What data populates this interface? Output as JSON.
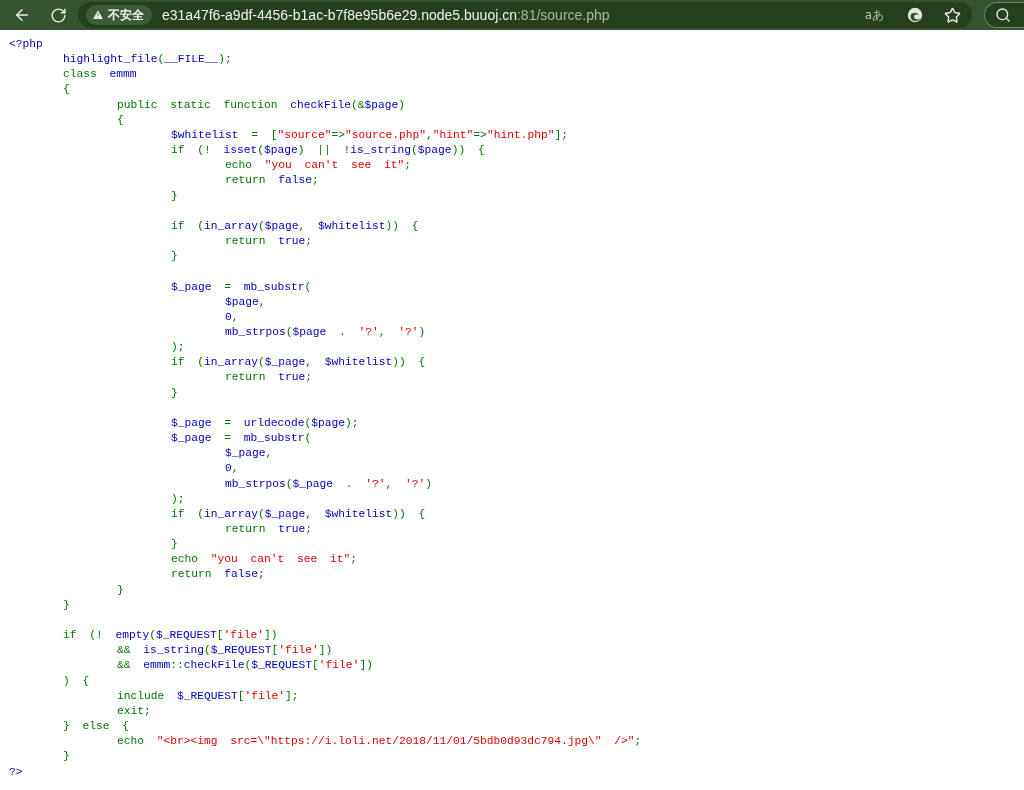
{
  "address_bar": {
    "security_label": "不安全",
    "url_host": "e31a47f6-a9df-4456-b1ac-b7f8e95b6e29.node5.buuoj.cn",
    "url_rest": ":81/source.php",
    "reader_label": "aあ"
  },
  "code_lines": [
    {
      "kind": "code",
      "segments": [
        {
          "kind": "default",
          "text": "<?php"
        }
      ],
      "children": [
        {
          "kind": "code",
          "segments": [
            {
              "kind": "default",
              "text": "highlight_file"
            },
            {
              "kind": "keyword",
              "text": "("
            },
            {
              "kind": "default",
              "text": "__FILE__"
            },
            {
              "kind": "keyword",
              "text": ");"
            }
          ]
        },
        {
          "kind": "code",
          "segments": [
            {
              "kind": "keyword",
              "text": "class "
            },
            {
              "kind": "default",
              "text": "emmm"
            }
          ]
        },
        {
          "kind": "code",
          "segments": [
            {
              "kind": "keyword",
              "text": "{"
            }
          ],
          "children": [
            {
              "kind": "code",
              "segments": [
                {
                  "kind": "keyword",
                  "text": "public static function "
                },
                {
                  "kind": "default",
                  "text": "checkFile"
                },
                {
                  "kind": "keyword",
                  "text": "(&"
                },
                {
                  "kind": "default",
                  "text": "$page"
                },
                {
                  "kind": "keyword",
                  "text": ")"
                }
              ]
            },
            {
              "kind": "code",
              "segments": [
                {
                  "kind": "keyword",
                  "text": "{"
                }
              ],
              "children": [
                {
                  "kind": "code",
                  "segments": [
                    {
                      "kind": "default",
                      "text": "$whitelist "
                    },
                    {
                      "kind": "keyword",
                      "text": "= ["
                    },
                    {
                      "kind": "string",
                      "text": "\"source\""
                    },
                    {
                      "kind": "keyword",
                      "text": "=>"
                    },
                    {
                      "kind": "string",
                      "text": "\"source.php\""
                    },
                    {
                      "kind": "keyword",
                      "text": ","
                    },
                    {
                      "kind": "string",
                      "text": "\"hint\""
                    },
                    {
                      "kind": "keyword",
                      "text": "=>"
                    },
                    {
                      "kind": "string",
                      "text": "\"hint.php\""
                    },
                    {
                      "kind": "keyword",
                      "text": "];"
                    }
                  ]
                },
                {
                  "kind": "code",
                  "segments": [
                    {
                      "kind": "keyword",
                      "text": "if (! "
                    },
                    {
                      "kind": "default",
                      "text": "isset"
                    },
                    {
                      "kind": "keyword",
                      "text": "("
                    },
                    {
                      "kind": "default",
                      "text": "$page"
                    },
                    {
                      "kind": "keyword",
                      "text": ") || !"
                    },
                    {
                      "kind": "default",
                      "text": "is_string"
                    },
                    {
                      "kind": "keyword",
                      "text": "("
                    },
                    {
                      "kind": "default",
                      "text": "$page"
                    },
                    {
                      "kind": "keyword",
                      "text": ")) {"
                    }
                  ],
                  "children": [
                    {
                      "kind": "code",
                      "segments": [
                        {
                          "kind": "keyword",
                          "text": "echo "
                        },
                        {
                          "kind": "string",
                          "text": "\"you can't see it\""
                        },
                        {
                          "kind": "keyword",
                          "text": ";"
                        }
                      ]
                    },
                    {
                      "kind": "code",
                      "segments": [
                        {
                          "kind": "keyword",
                          "text": "return "
                        },
                        {
                          "kind": "default",
                          "text": "false"
                        },
                        {
                          "kind": "keyword",
                          "text": ";"
                        }
                      ]
                    }
                  ]
                },
                {
                  "kind": "code",
                  "segments": [
                    {
                      "kind": "keyword",
                      "text": "}"
                    }
                  ]
                },
                {
                  "kind": "blank"
                },
                {
                  "kind": "code",
                  "segments": [
                    {
                      "kind": "keyword",
                      "text": "if ("
                    },
                    {
                      "kind": "default",
                      "text": "in_array"
                    },
                    {
                      "kind": "keyword",
                      "text": "("
                    },
                    {
                      "kind": "default",
                      "text": "$page"
                    },
                    {
                      "kind": "keyword",
                      "text": ", "
                    },
                    {
                      "kind": "default",
                      "text": "$whitelist"
                    },
                    {
                      "kind": "keyword",
                      "text": ")) {"
                    }
                  ],
                  "children": [
                    {
                      "kind": "code",
                      "segments": [
                        {
                          "kind": "keyword",
                          "text": "return "
                        },
                        {
                          "kind": "default",
                          "text": "true"
                        },
                        {
                          "kind": "keyword",
                          "text": ";"
                        }
                      ]
                    }
                  ]
                },
                {
                  "kind": "code",
                  "segments": [
                    {
                      "kind": "keyword",
                      "text": "}"
                    }
                  ]
                },
                {
                  "kind": "blank"
                },
                {
                  "kind": "code",
                  "segments": [
                    {
                      "kind": "default",
                      "text": "$_page "
                    },
                    {
                      "kind": "keyword",
                      "text": "= "
                    },
                    {
                      "kind": "default",
                      "text": "mb_substr"
                    },
                    {
                      "kind": "keyword",
                      "text": "("
                    }
                  ],
                  "children": [
                    {
                      "kind": "code",
                      "segments": [
                        {
                          "kind": "default",
                          "text": "$page"
                        },
                        {
                          "kind": "keyword",
                          "text": ","
                        }
                      ]
                    },
                    {
                      "kind": "code",
                      "segments": [
                        {
                          "kind": "default",
                          "text": "0"
                        },
                        {
                          "kind": "keyword",
                          "text": ","
                        }
                      ]
                    },
                    {
                      "kind": "code",
                      "segments": [
                        {
                          "kind": "default",
                          "text": "mb_strpos"
                        },
                        {
                          "kind": "keyword",
                          "text": "("
                        },
                        {
                          "kind": "default",
                          "text": "$page "
                        },
                        {
                          "kind": "keyword",
                          "text": ". "
                        },
                        {
                          "kind": "string",
                          "text": "'?'"
                        },
                        {
                          "kind": "keyword",
                          "text": ", "
                        },
                        {
                          "kind": "string",
                          "text": "'?'"
                        },
                        {
                          "kind": "keyword",
                          "text": ")"
                        }
                      ]
                    }
                  ]
                },
                {
                  "kind": "code",
                  "segments": [
                    {
                      "kind": "keyword",
                      "text": ");"
                    }
                  ]
                },
                {
                  "kind": "code",
                  "segments": [
                    {
                      "kind": "keyword",
                      "text": "if ("
                    },
                    {
                      "kind": "default",
                      "text": "in_array"
                    },
                    {
                      "kind": "keyword",
                      "text": "("
                    },
                    {
                      "kind": "default",
                      "text": "$_page"
                    },
                    {
                      "kind": "keyword",
                      "text": ", "
                    },
                    {
                      "kind": "default",
                      "text": "$whitelist"
                    },
                    {
                      "kind": "keyword",
                      "text": ")) {"
                    }
                  ],
                  "children": [
                    {
                      "kind": "code",
                      "segments": [
                        {
                          "kind": "keyword",
                          "text": "return "
                        },
                        {
                          "kind": "default",
                          "text": "true"
                        },
                        {
                          "kind": "keyword",
                          "text": ";"
                        }
                      ]
                    }
                  ]
                },
                {
                  "kind": "code",
                  "segments": [
                    {
                      "kind": "keyword",
                      "text": "}"
                    }
                  ]
                },
                {
                  "kind": "blank"
                },
                {
                  "kind": "code",
                  "segments": [
                    {
                      "kind": "default",
                      "text": "$_page "
                    },
                    {
                      "kind": "keyword",
                      "text": "= "
                    },
                    {
                      "kind": "default",
                      "text": "urldecode"
                    },
                    {
                      "kind": "keyword",
                      "text": "("
                    },
                    {
                      "kind": "default",
                      "text": "$page"
                    },
                    {
                      "kind": "keyword",
                      "text": ");"
                    }
                  ]
                },
                {
                  "kind": "code",
                  "segments": [
                    {
                      "kind": "default",
                      "text": "$_page "
                    },
                    {
                      "kind": "keyword",
                      "text": "= "
                    },
                    {
                      "kind": "default",
                      "text": "mb_substr"
                    },
                    {
                      "kind": "keyword",
                      "text": "("
                    }
                  ],
                  "children": [
                    {
                      "kind": "code",
                      "segments": [
                        {
                          "kind": "default",
                          "text": "$_page"
                        },
                        {
                          "kind": "keyword",
                          "text": ","
                        }
                      ]
                    },
                    {
                      "kind": "code",
                      "segments": [
                        {
                          "kind": "default",
                          "text": "0"
                        },
                        {
                          "kind": "keyword",
                          "text": ","
                        }
                      ]
                    },
                    {
                      "kind": "code",
                      "segments": [
                        {
                          "kind": "default",
                          "text": "mb_strpos"
                        },
                        {
                          "kind": "keyword",
                          "text": "("
                        },
                        {
                          "kind": "default",
                          "text": "$_page "
                        },
                        {
                          "kind": "keyword",
                          "text": ". "
                        },
                        {
                          "kind": "string",
                          "text": "'?'"
                        },
                        {
                          "kind": "keyword",
                          "text": ", "
                        },
                        {
                          "kind": "string",
                          "text": "'?'"
                        },
                        {
                          "kind": "keyword",
                          "text": ")"
                        }
                      ]
                    }
                  ]
                },
                {
                  "kind": "code",
                  "segments": [
                    {
                      "kind": "keyword",
                      "text": ");"
                    }
                  ]
                },
                {
                  "kind": "code",
                  "segments": [
                    {
                      "kind": "keyword",
                      "text": "if ("
                    },
                    {
                      "kind": "default",
                      "text": "in_array"
                    },
                    {
                      "kind": "keyword",
                      "text": "("
                    },
                    {
                      "kind": "default",
                      "text": "$_page"
                    },
                    {
                      "kind": "keyword",
                      "text": ", "
                    },
                    {
                      "kind": "default",
                      "text": "$whitelist"
                    },
                    {
                      "kind": "keyword",
                      "text": ")) {"
                    }
                  ],
                  "children": [
                    {
                      "kind": "code",
                      "segments": [
                        {
                          "kind": "keyword",
                          "text": "return "
                        },
                        {
                          "kind": "default",
                          "text": "true"
                        },
                        {
                          "kind": "keyword",
                          "text": ";"
                        }
                      ]
                    }
                  ]
                },
                {
                  "kind": "code",
                  "segments": [
                    {
                      "kind": "keyword",
                      "text": "}"
                    }
                  ]
                },
                {
                  "kind": "code",
                  "segments": [
                    {
                      "kind": "keyword",
                      "text": "echo "
                    },
                    {
                      "kind": "string",
                      "text": "\"you can't see it\""
                    },
                    {
                      "kind": "keyword",
                      "text": ";"
                    }
                  ]
                },
                {
                  "kind": "code",
                  "segments": [
                    {
                      "kind": "keyword",
                      "text": "return "
                    },
                    {
                      "kind": "default",
                      "text": "false"
                    },
                    {
                      "kind": "keyword",
                      "text": ";"
                    }
                  ]
                }
              ]
            },
            {
              "kind": "code",
              "segments": [
                {
                  "kind": "keyword",
                  "text": "}"
                }
              ]
            }
          ]
        },
        {
          "kind": "code",
          "segments": [
            {
              "kind": "keyword",
              "text": "}"
            }
          ]
        },
        {
          "kind": "blank"
        },
        {
          "kind": "code",
          "segments": [
            {
              "kind": "keyword",
              "text": "if (! "
            },
            {
              "kind": "default",
              "text": "empty"
            },
            {
              "kind": "keyword",
              "text": "("
            },
            {
              "kind": "default",
              "text": "$_REQUEST"
            },
            {
              "kind": "keyword",
              "text": "["
            },
            {
              "kind": "string",
              "text": "'file'"
            },
            {
              "kind": "keyword",
              "text": "])"
            }
          ],
          "children": [
            {
              "kind": "code",
              "segments": [
                {
                  "kind": "keyword",
                  "text": "&& "
                },
                {
                  "kind": "default",
                  "text": "is_string"
                },
                {
                  "kind": "keyword",
                  "text": "("
                },
                {
                  "kind": "default",
                  "text": "$_REQUEST"
                },
                {
                  "kind": "keyword",
                  "text": "["
                },
                {
                  "kind": "string",
                  "text": "'file'"
                },
                {
                  "kind": "keyword",
                  "text": "])"
                }
              ]
            },
            {
              "kind": "code",
              "segments": [
                {
                  "kind": "keyword",
                  "text": "&& "
                },
                {
                  "kind": "default",
                  "text": "emmm"
                },
                {
                  "kind": "keyword",
                  "text": "::"
                },
                {
                  "kind": "default",
                  "text": "checkFile"
                },
                {
                  "kind": "keyword",
                  "text": "("
                },
                {
                  "kind": "default",
                  "text": "$_REQUEST"
                },
                {
                  "kind": "keyword",
                  "text": "["
                },
                {
                  "kind": "string",
                  "text": "'file'"
                },
                {
                  "kind": "keyword",
                  "text": "])"
                }
              ]
            }
          ]
        },
        {
          "kind": "code",
          "segments": [
            {
              "kind": "keyword",
              "text": ") {"
            }
          ],
          "children": [
            {
              "kind": "code",
              "segments": [
                {
                  "kind": "keyword",
                  "text": "include "
                },
                {
                  "kind": "default",
                  "text": "$_REQUEST"
                },
                {
                  "kind": "keyword",
                  "text": "["
                },
                {
                  "kind": "string",
                  "text": "'file'"
                },
                {
                  "kind": "keyword",
                  "text": "];"
                }
              ]
            },
            {
              "kind": "code",
              "segments": [
                {
                  "kind": "keyword",
                  "text": "exit;"
                }
              ]
            }
          ]
        },
        {
          "kind": "code",
          "segments": [
            {
              "kind": "keyword",
              "text": "} else {"
            }
          ],
          "children": [
            {
              "kind": "code",
              "segments": [
                {
                  "kind": "keyword",
                  "text": "echo "
                },
                {
                  "kind": "string",
                  "text": "\"<br><img src=\\\"https://i.loli.net/2018/11/01/5bdb0d93dc794.jpg\\\" />\""
                },
                {
                  "kind": "keyword",
                  "text": ";"
                }
              ]
            }
          ]
        },
        {
          "kind": "code",
          "segments": [
            {
              "kind": "keyword",
              "text": "}"
            }
          ]
        }
      ]
    },
    {
      "kind": "code",
      "segments": [
        {
          "kind": "default",
          "text": "?>"
        }
      ]
    }
  ]
}
